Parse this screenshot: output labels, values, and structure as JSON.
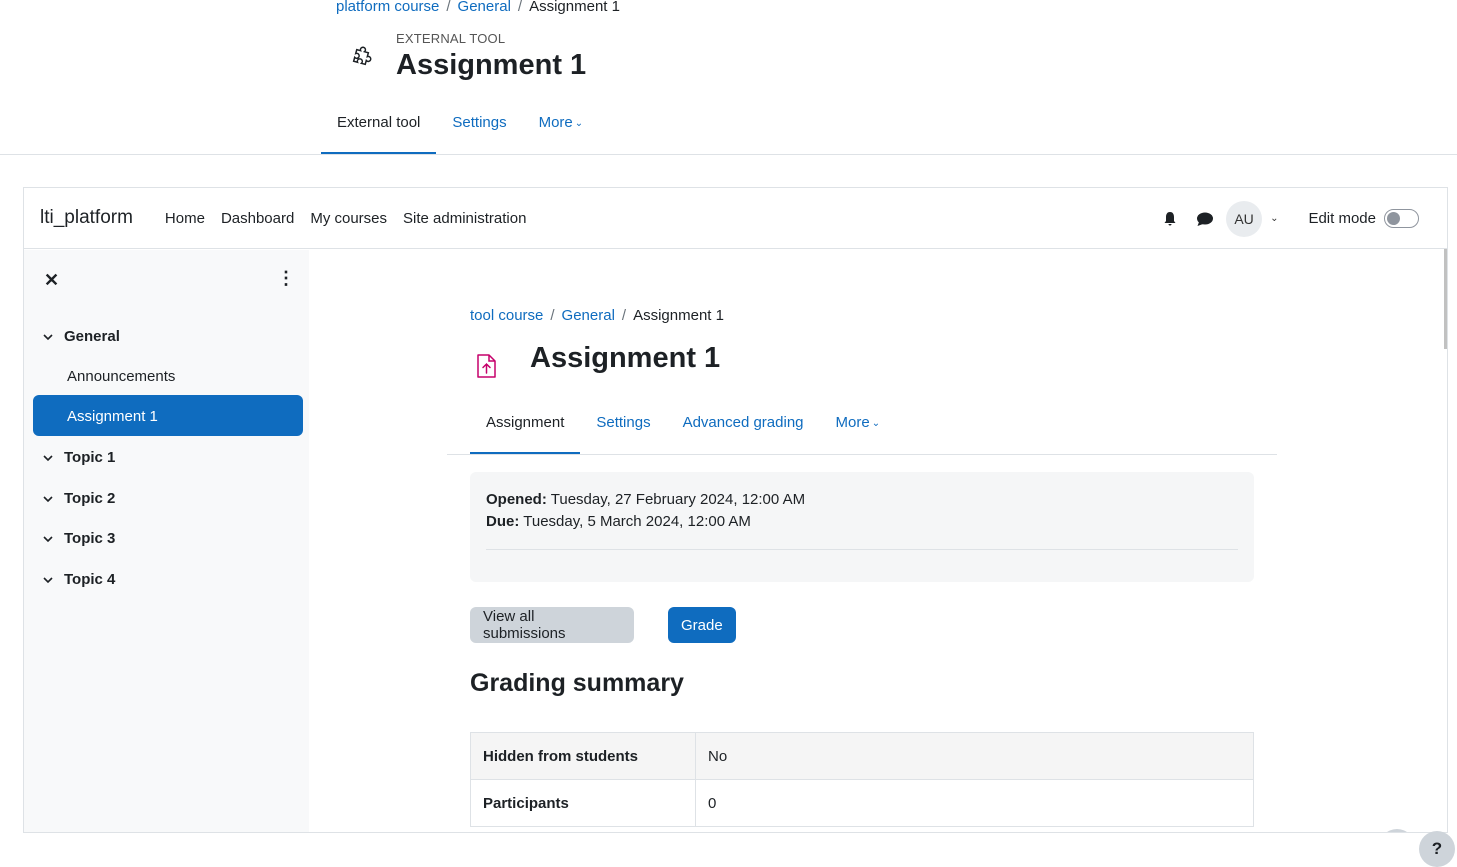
{
  "outer": {
    "breadcrumb": [
      "platform course",
      "General",
      "Assignment 1"
    ],
    "kicker": "EXTERNAL TOOL",
    "title": "Assignment 1",
    "tabs": [
      {
        "label": "External tool"
      },
      {
        "label": "Settings"
      },
      {
        "label": "More"
      }
    ]
  },
  "navbar": {
    "brand": "lti_platform",
    "items": [
      "Home",
      "Dashboard",
      "My courses",
      "Site administration"
    ],
    "avatar": "AU",
    "edit_mode_label": "Edit mode"
  },
  "drawer": {
    "sections": [
      "General",
      "Topic 1",
      "Topic 2",
      "Topic 3",
      "Topic 4"
    ],
    "activities": [
      "Announcements",
      "Assignment 1"
    ]
  },
  "content": {
    "breadcrumb": [
      "tool course",
      "General",
      "Assignment 1"
    ],
    "title": "Assignment 1",
    "tabs": [
      "Assignment",
      "Settings",
      "Advanced grading",
      "More"
    ],
    "opened_label": "Opened:",
    "opened_value": "Tuesday, 27 February 2024, 12:00 AM",
    "due_label": "Due:",
    "due_value": "Tuesday, 5 March 2024, 12:00 AM",
    "view_all_label": "View all submissions",
    "grade_label": "Grade",
    "summary_title": "Grading summary",
    "summary_rows": [
      {
        "label": "Hidden from students",
        "value": "No"
      },
      {
        "label": "Participants",
        "value": "0"
      }
    ]
  },
  "help": "?",
  "colors": {
    "accent": "#0f6cbf",
    "assignment_icon": "#c6006b"
  }
}
